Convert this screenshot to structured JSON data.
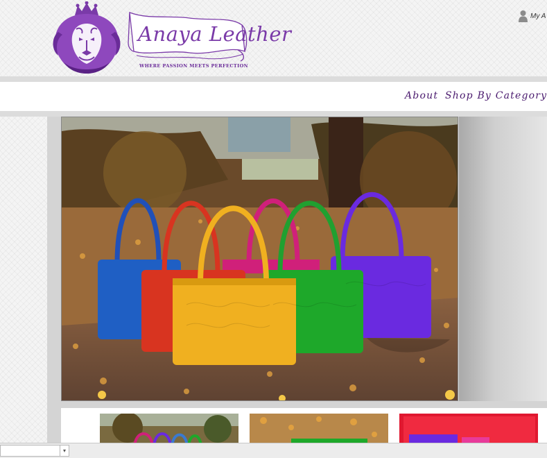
{
  "brand": {
    "name": "Anaya Leather",
    "tagline": "WHERE PASSION MEETS PERFECTION",
    "primary_color": "#7a3aa8",
    "logo_icon": "lion-crest-icon"
  },
  "account": {
    "label": "My A",
    "icon": "user-icon"
  },
  "nav": {
    "items": [
      {
        "label": "About"
      },
      {
        "label": "Shop By Category"
      }
    ]
  },
  "hero": {
    "image": "colorful-handbags-photo",
    "bag_colors": [
      "#1f5fc4",
      "#d83420",
      "#f0b020",
      "#d0207a",
      "#1ea82a",
      "#6a2ae0"
    ]
  },
  "thumbnails": [
    {
      "image": "handbags-autumn-thumb"
    },
    {
      "image": "handbags-leaves-thumb"
    },
    {
      "image": "handbags-red-backdrop-thumb"
    }
  ]
}
